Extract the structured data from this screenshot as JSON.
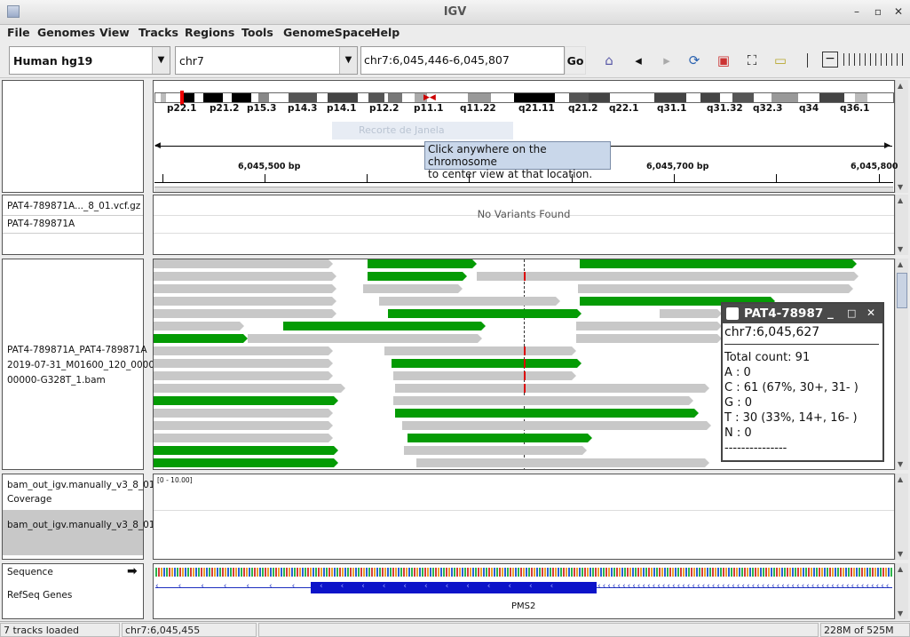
{
  "window": {
    "title": "IGV"
  },
  "menu": [
    "File",
    "Genomes",
    "View",
    "Tracks",
    "Regions",
    "Tools",
    "GenomeSpace",
    "Help"
  ],
  "toolbar": {
    "genome": "Human hg19",
    "chromosome": "chr7",
    "locus": "chr7:6,045,446-6,045,807",
    "go": "Go"
  },
  "ideogram": {
    "bands": [
      "p22.1",
      "p21.2",
      "p15.3",
      "p14.3",
      "p14.1",
      "p12.2",
      "p11.1",
      "q11.22",
      "q21.11",
      "q21.2",
      "q22.1",
      "q31.1",
      "q31.32",
      "q32.3",
      "q34",
      "q36.1"
    ]
  },
  "ruler": {
    "ticks": [
      "6,045,500 bp",
      "6,045,700 bp",
      "6,045,800"
    ]
  },
  "tooltip": {
    "line1": "Click anywhere on the chromosome",
    "line2": "to center view at that location."
  },
  "ghost": "Recorte de Janela",
  "variants": {
    "track1": "PAT4-789871A..._8_01.vcf.gz",
    "track2": "PAT4-789871A",
    "message": "No Variants Found"
  },
  "alignment": {
    "label1": "PAT4-789871A_PAT4-789871A",
    "label2": "2019-07-31_M01600_120_0000",
    "label3": "00000-G328T_1.bam"
  },
  "popup": {
    "title": "PAT4-78987",
    "pos": "chr7:6,045,627",
    "total": "Total count: 91",
    "a": "A : 0",
    "c": "C : 61 (67%, 30+, 31- )",
    "g": "G : 0",
    "t": "T : 30 (33%, 14+, 16- )",
    "n": "N : 0",
    "dashes": "---------------"
  },
  "bottom": {
    "track1": "bam_out_igv.manually_v3_8_01.",
    "coverage": "Coverage",
    "track2": "bam_out_igv.manually_v3_8_01.",
    "range": "[0 - 10.00]"
  },
  "feature": {
    "sequence": "Sequence",
    "refseq": "RefSeq Genes",
    "gene": "PMS2"
  },
  "status": {
    "tracks": "7 tracks loaded",
    "pos": "chr7:6,045,455",
    "mem": "228M of 525M"
  }
}
